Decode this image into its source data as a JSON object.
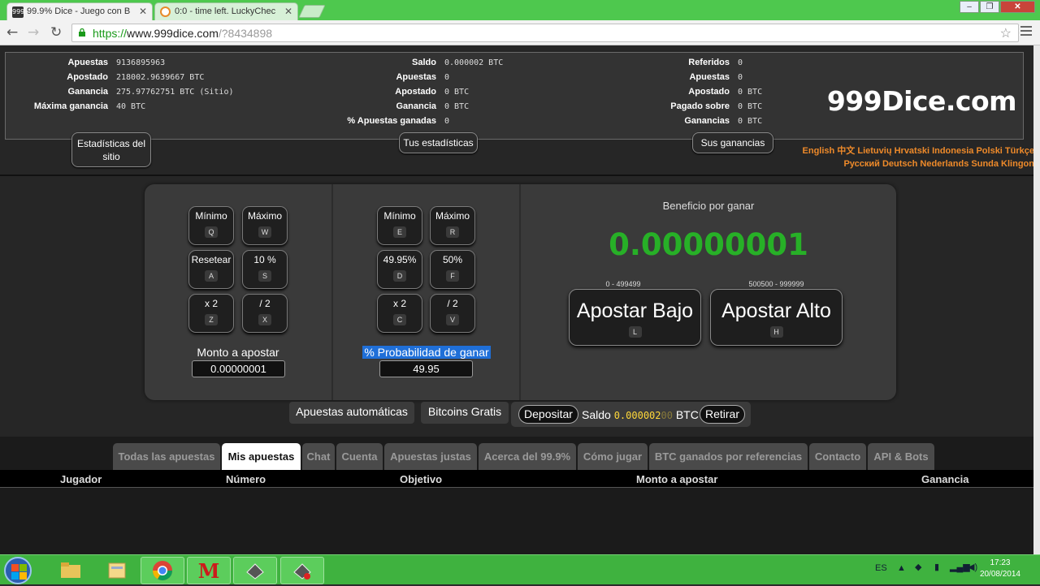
{
  "browser": {
    "tabs": [
      {
        "favicon": "999",
        "title": "99.9% Dice - Juego con B"
      },
      {
        "favicon": "",
        "title": "0:0 - time left. LuckyChec"
      }
    ],
    "url": {
      "scheme": "https://",
      "host": "www.999dice.com",
      "path": "/?8434898"
    }
  },
  "stats": {
    "site": [
      {
        "label": "Apuestas",
        "value": "9136895963"
      },
      {
        "label": "Apostado",
        "value": "218002.9639667 BTC"
      },
      {
        "label": "Ganancia",
        "value": "275.97762751 BTC (Sitio)"
      },
      {
        "label": "Máxima ganancia",
        "value": "40 BTC"
      }
    ],
    "user": [
      {
        "label": "Saldo",
        "value": "0.000002 BTC"
      },
      {
        "label": "Apuestas",
        "value": "0"
      },
      {
        "label": "Apostado",
        "value": "0 BTC"
      },
      {
        "label": "Ganancia",
        "value": "0 BTC"
      },
      {
        "label": "% Apuestas ganadas",
        "value": "0"
      }
    ],
    "referral": [
      {
        "label": "Referidos",
        "value": "0"
      },
      {
        "label": "Apuestas",
        "value": "0"
      },
      {
        "label": "Apostado",
        "value": "0 BTC"
      },
      {
        "label": "Pagado sobre",
        "value": "0 BTC"
      },
      {
        "label": "Ganancias",
        "value": "0 BTC"
      }
    ],
    "brand": "999Dice.com",
    "buttons": {
      "site": "Estadísticas del sitio",
      "user": "Tus estadísticas",
      "referral": "Sus ganancias"
    }
  },
  "languages": {
    "line1": "English 中文 Lietuvių Hrvatski Indonesia Polski Türkçe",
    "line2": "Русский Deutsch Nederlands Sunda Klingon"
  },
  "bet": {
    "amount_buttons": [
      {
        "label": "Mínimo",
        "key": "Q"
      },
      {
        "label": "Máximo",
        "key": "W"
      },
      {
        "label": "Resetear",
        "key": "A"
      },
      {
        "label": "10 %",
        "key": "S"
      },
      {
        "label": "x 2",
        "key": "Z"
      },
      {
        "label": "/ 2",
        "key": "X"
      }
    ],
    "amount_label": "Monto a apostar",
    "amount_value": "0.00000001",
    "chance_buttons": [
      {
        "label": "Mínimo",
        "key": "E"
      },
      {
        "label": "Máximo",
        "key": "R"
      },
      {
        "label": "49.95%",
        "key": "D"
      },
      {
        "label": "50%",
        "key": "F"
      },
      {
        "label": "x 2",
        "key": "C"
      },
      {
        "label": "/ 2",
        "key": "V"
      }
    ],
    "chance_label": "% Probabilidad de ganar",
    "chance_value": "49.95",
    "profit_label": "Beneficio por ganar",
    "profit_value": "0.00000001",
    "low": {
      "range": "0 - 499499",
      "label": "Apostar Bajo",
      "key": "L"
    },
    "high": {
      "range": "500500 - 999999",
      "label": "Apostar Alto",
      "key": "H"
    },
    "accent_color": "#27b027"
  },
  "actions": {
    "auto": "Apuestas automáticas",
    "free": "Bitcoins Gratis",
    "deposit": "Depositar",
    "balance_label": "Saldo",
    "balance_bright": "0.000002",
    "balance_dim": "00",
    "balance_unit": "BTC",
    "withdraw": "Retirar"
  },
  "bottom_tabs": [
    "Todas las apuestas",
    "Mis apuestas",
    "Chat",
    "Cuenta",
    "Apuestas justas",
    "Acerca del 99.9%",
    "Cómo jugar",
    "BTC ganados por referencias",
    "Contacto",
    "API & Bots"
  ],
  "active_bottom_tab": "Mis apuestas",
  "table_headers": [
    "Jugador",
    "Número",
    "Objetivo",
    "Monto a apostar",
    "Ganancia"
  ],
  "taskbar": {
    "lang": "ES",
    "time": "17:23",
    "date": "20/08/2014"
  }
}
